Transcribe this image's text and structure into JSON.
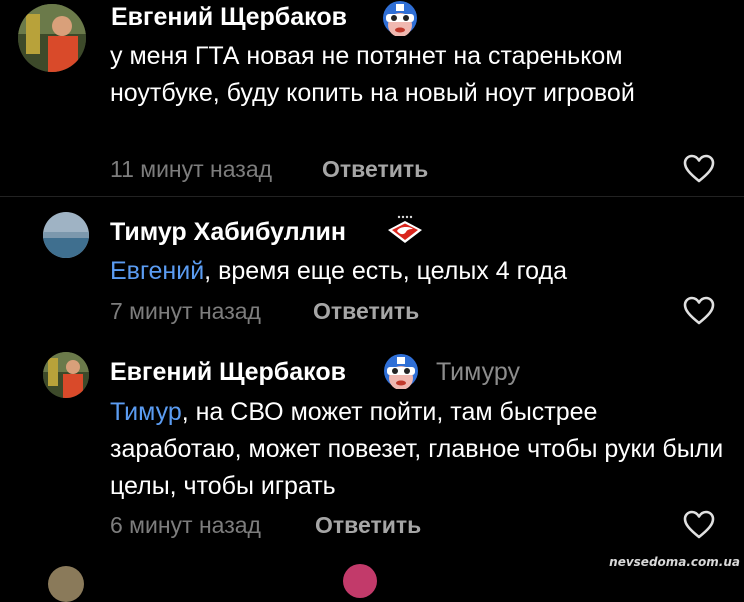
{
  "comments": [
    {
      "author": "Евгений Щербаков",
      "badge_icon": "captain-mask-badge-icon",
      "text": "у меня ГТА новая не потянет на стареньком ноутбуке, буду копить на новый ноут игровой",
      "time": "11 минут назад",
      "reply_label": "Ответить"
    },
    {
      "author": "Тимур Хабибуллин",
      "badge_icon": "spartak-badge-icon",
      "mention": "Евгений",
      "text": ", время еще есть, целых 4 года",
      "time": "7 минут назад",
      "reply_label": "Ответить"
    },
    {
      "author": "Евгений Щербаков",
      "badge_icon": "captain-mask-badge-icon",
      "reply_to": "Тимуру",
      "mention": "Тимур",
      "text": ", на СВО может пойти, там быстрее заработаю, может повезет, главное чтобы руки были целы, чтобы играть",
      "time": "6 минут назад",
      "reply_label": "Ответить"
    }
  ],
  "watermark": "nevsedoma.com.ua",
  "colors": {
    "background": "#000000",
    "mention": "#5b9cf2",
    "meta": "#7d7d7d"
  }
}
